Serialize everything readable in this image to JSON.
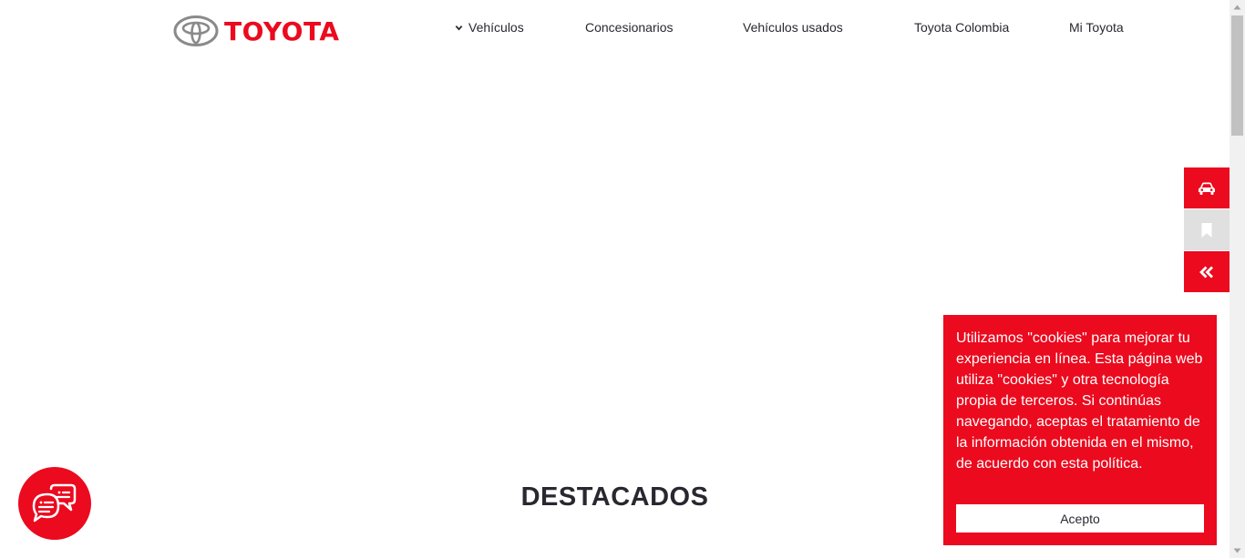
{
  "brand": {
    "name": "TOYOTA",
    "accent_color": "#eb0a1e",
    "text_color": "#282830"
  },
  "nav": {
    "items": [
      {
        "label": "Vehículos",
        "icon": "chevron-down-icon"
      },
      {
        "label": "Concesionarios"
      },
      {
        "label": "Vehículos usados"
      },
      {
        "label": "Toyota Colombia"
      },
      {
        "label": "Mi Toyota"
      }
    ]
  },
  "side_actions": [
    {
      "icon": "car-icon"
    },
    {
      "icon": "bookmark-icon"
    },
    {
      "icon": "double-chevron-left-icon"
    }
  ],
  "main": {
    "section_title": "DESTACADOS"
  },
  "chat": {
    "icon": "chat-bubbles-icon"
  },
  "cookie_banner": {
    "text": "Utilizamos \"cookies\" para mejorar tu experiencia en línea. Esta página web utiliza \"cookies\" y otra tecnología propia de terceros. Si continúas navegando, aceptas el tratamiento de la información obtenida en el mismo, de acuerdo con esta política.",
    "accept_label": "Acepto"
  }
}
